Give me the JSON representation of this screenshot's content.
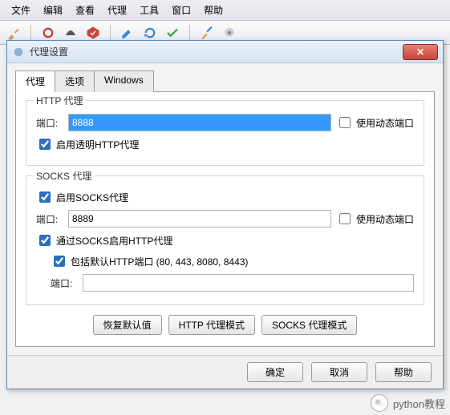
{
  "menu": {
    "items": [
      "文件",
      "编辑",
      "查看",
      "代理",
      "工具",
      "窗口",
      "帮助"
    ]
  },
  "dialog": {
    "title": "代理设置",
    "tabs": [
      "代理",
      "选项",
      "Windows"
    ],
    "http": {
      "legend": "HTTP 代理",
      "portLabel": "端口:",
      "port": "8888",
      "dynamicPort": "使用动态端口",
      "transparent": "启用透明HTTP代理"
    },
    "socks": {
      "legend": "SOCKS 代理",
      "enable": "启用SOCKS代理",
      "portLabel": "端口:",
      "port": "8889",
      "dynamicPort": "使用动态端口",
      "httpOverSocks": "通过SOCKS启用HTTP代理",
      "includeDefault": "包括默认HTTP端口 (80, 443, 8080, 8443)",
      "innerPortLabel": "端口:",
      "innerPort": ""
    },
    "buttons": {
      "restore": "恢复默认值",
      "httpMode": "HTTP 代理模式",
      "socksMode": "SOCKS 代理模式",
      "ok": "确定",
      "cancel": "取消",
      "help": "帮助"
    }
  },
  "watermark": "python教程"
}
